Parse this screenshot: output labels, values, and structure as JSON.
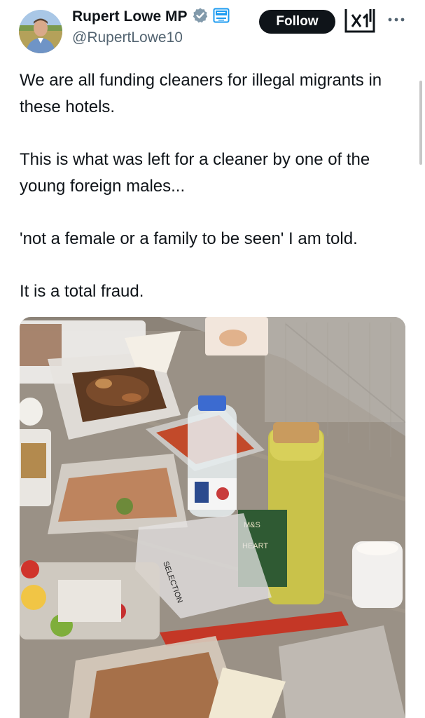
{
  "post": {
    "author": {
      "name": "Rupert Lowe MP",
      "handle": "@RupertLowe10",
      "verified_icon": "verified-badge-icon",
      "affiliation_icon": "affiliation-badge-icon"
    },
    "follow_label": "Follow",
    "grok_icon": "grok-icon",
    "more_icon": "more-dots-icon",
    "paragraphs": [
      "We are all funding cleaners for illegal migrants in these hotels.",
      "This is what was left for a cleaner by one of the young foreign males...",
      "'not a female or a family to be seen' I am told.",
      "It is a total fraud."
    ],
    "photo": {
      "bottle_label_brand": "M&S",
      "bottle_label_text": "HEART",
      "bag_text": "SELECTION"
    }
  },
  "colors": {
    "text_primary": "#0f1419",
    "text_secondary": "#536471",
    "follow_bg": "#0f1419",
    "verified_grey": "#829aab",
    "affiliation_blue": "#1d9bf0"
  }
}
